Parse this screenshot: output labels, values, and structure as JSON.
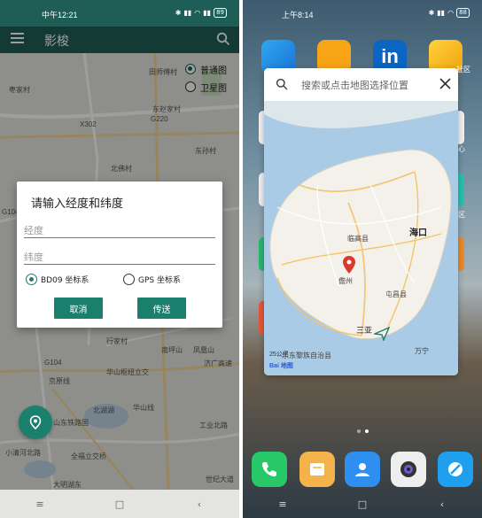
{
  "left": {
    "status": {
      "time": "中午12:21",
      "battery": "89"
    },
    "appbar": {
      "title": "影梭"
    },
    "map_type": {
      "options": [
        "普通图",
        "卫星图"
      ],
      "selected": "普通图"
    },
    "map_labels": {
      "l1": "田师傅村",
      "l2": "枣家村",
      "l3": "东赵家村",
      "l4": "X302",
      "l5": "G220",
      "l6": "东孙村",
      "l7": "北佛村",
      "l8": "G104",
      "l9": "行家村",
      "l10": "G104",
      "l11": "南坪山",
      "l12": "凤凰山",
      "l13": "济广高速",
      "l14": "华山枢纽立交",
      "l15": "京原线",
      "l16": "华山线",
      "l17": "工业北路",
      "l18": "北湖湖",
      "l19": "山东铁路国",
      "l20": "小清河北路",
      "l21": "全福立交桥",
      "l22": "世纪大道",
      "l23": "大明湖东"
    },
    "dialog": {
      "title": "请输入经度和纬度",
      "longitude": {
        "placeholder": "经度",
        "value": ""
      },
      "latitude": {
        "placeholder": "纬度",
        "value": ""
      },
      "coord_options": [
        "BD09 坐标系",
        "GPS 坐标系"
      ],
      "selected_coord": "BD09 坐标系",
      "cancel_label": "取消",
      "send_label": "传送"
    },
    "nav": {
      "menu": "≡",
      "home": "□",
      "back": "‹"
    }
  },
  "right": {
    "status": {
      "time": "上午8:14",
      "battery": "88"
    },
    "top_row_partial_label": "社区",
    "picker": {
      "search_placeholder": "搜索或点击地图选择位置",
      "labels": {
        "haikou": "海口",
        "lingao": "临高县",
        "danzhou": "儋州",
        "tunchang": "屯昌县",
        "wanning": "万宁",
        "ledong": "乐东黎族自治县",
        "sanya": "三亚"
      },
      "scale": "25公里",
      "logo": "Bai 地图"
    },
    "side_partial": [
      "心",
      "区"
    ],
    "nav": {
      "menu": "≡",
      "home": "□",
      "back": "‹"
    },
    "colors": {
      "accent": "#1a7f6c",
      "pin": "#d93a2f",
      "water": "#a9cbe6",
      "land": "#f3f1ea"
    }
  }
}
